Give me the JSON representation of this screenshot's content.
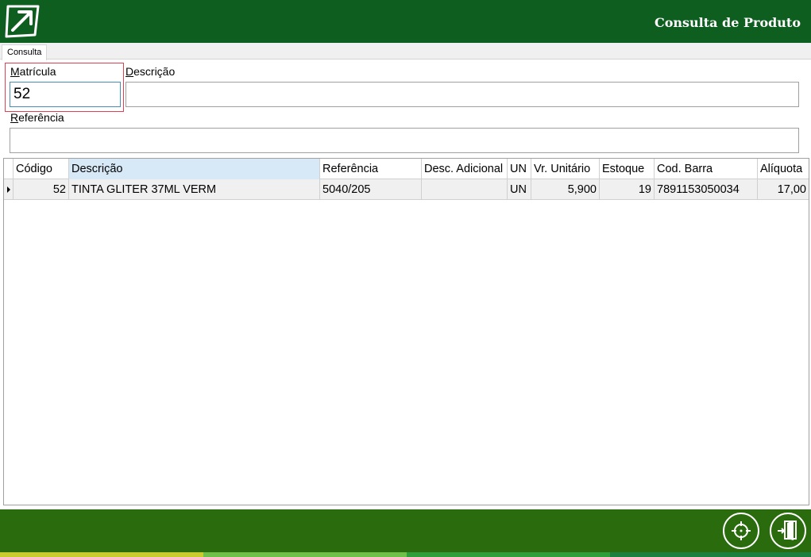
{
  "header": {
    "title": "Consulta de Produto",
    "logo": "arrow-logo-icon",
    "color": "#0e5e20"
  },
  "tabs": [
    {
      "label": "Consulta"
    }
  ],
  "form": {
    "matricula": {
      "label_key": "M",
      "label_rest": "atrícula",
      "value": "52"
    },
    "descricao": {
      "label_key": "D",
      "label_rest": "escrição",
      "value": ""
    },
    "referencia": {
      "label_key": "R",
      "label_rest": "eferência",
      "value": ""
    }
  },
  "grid": {
    "columns": [
      "Código",
      "Descrição",
      "Referência",
      "Desc. Adicional",
      "UN",
      "Vr. Unitário",
      "Estoque",
      "Cod. Barra",
      "Alíquota"
    ],
    "rows": [
      [
        "52",
        "TINTA GLITER 37ML VERM",
        "5040/205",
        "",
        "UN",
        "5,900",
        "19",
        "7891153050034",
        "17,00"
      ]
    ]
  },
  "footer": {
    "color": "#2a6b0e",
    "buttons": [
      {
        "icon": "crosshair-icon"
      },
      {
        "icon": "exit-door-icon"
      }
    ],
    "stripe_colors": [
      "#c9cc2e",
      "#6fc04a",
      "#2f9e3a",
      "#1d7f3e"
    ]
  }
}
